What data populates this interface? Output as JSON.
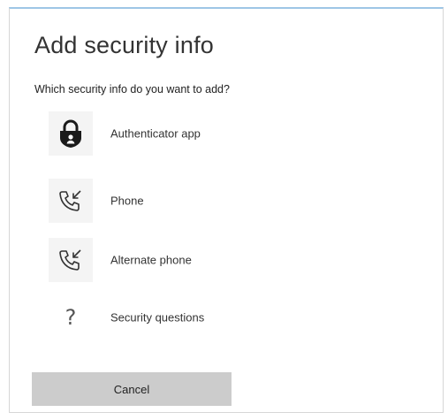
{
  "dialog": {
    "title": "Add security info",
    "question": "Which security info do you want to add?",
    "options": [
      {
        "label": "Authenticator app",
        "icon": "lock-icon"
      },
      {
        "label": "Phone",
        "icon": "phone-incoming-icon"
      },
      {
        "label": "Alternate phone",
        "icon": "phone-incoming-icon"
      },
      {
        "label": "Security questions",
        "icon": "question-mark-icon",
        "glyph": "?"
      }
    ],
    "cancel_label": "Cancel"
  },
  "colors": {
    "title_text": "#333333",
    "icon_fill": "#1a1a1a",
    "cancel_bg": "#cccccc"
  }
}
